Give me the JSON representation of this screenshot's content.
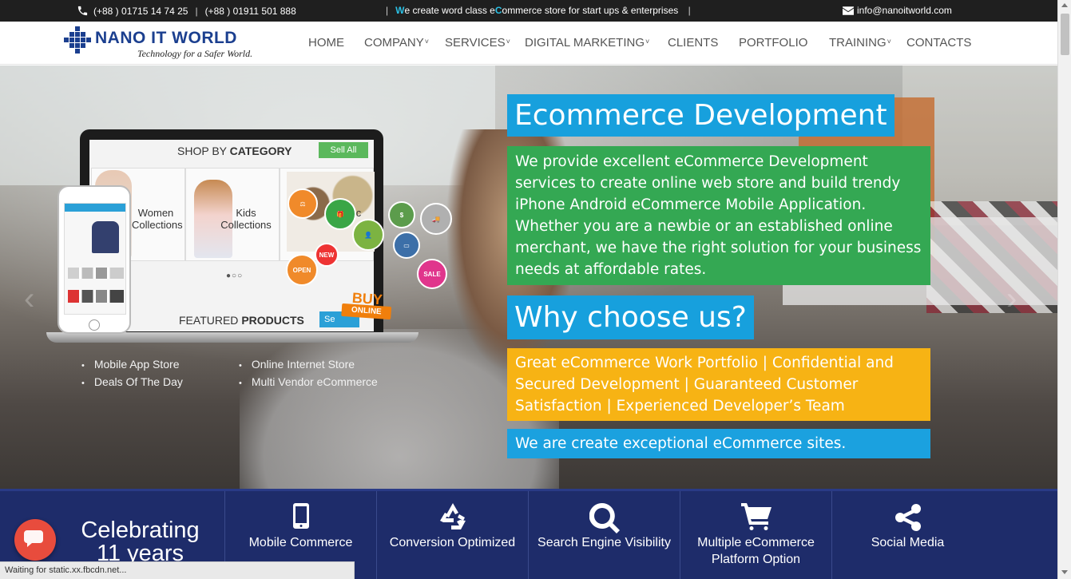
{
  "topbar": {
    "phone1": "(+88 ) 01715 14 74 25",
    "separator": "|",
    "phone2": "(+88 ) 01911 501 888",
    "tagline_prefix": "W",
    "tagline_mid1": "e create word class e",
    "tagline_hl2": "C",
    "tagline_rest": "ommerce store for start ups & enterprises",
    "tagline_bar": "|",
    "email": "info@nanoitworld.com"
  },
  "logo": {
    "name": "NANO IT WORLD",
    "slogan": "Technology for a Safer World."
  },
  "nav": {
    "items": [
      {
        "label": "HOME",
        "has_caret": false
      },
      {
        "label": "COMPANY",
        "has_caret": true
      },
      {
        "label": "SERVICES",
        "has_caret": true
      },
      {
        "label": "DIGITAL MARKETING",
        "has_caret": true
      },
      {
        "label": "CLIENTS",
        "has_caret": false
      },
      {
        "label": "PORTFOLIO",
        "has_caret": false
      },
      {
        "label": "TRAINING",
        "has_caret": true
      },
      {
        "label": "CONTACTS",
        "has_caret": false
      }
    ],
    "caret": "˅"
  },
  "hero_image": {
    "shop_title_a": "SHOP BY ",
    "shop_title_b": "CATEGORY",
    "sell_all": "Sell All",
    "cat_women": "Women Collections",
    "cat_kids": "Kids Collections",
    "cat_acc": "on Ac",
    "dots": "●○○",
    "featured_a": "FEATURED ",
    "featured_b": "PRODUCTS",
    "sell_btn2": "Se",
    "buy": "BUY",
    "online": "ONLINE",
    "badge_open": "OPEN",
    "badge_new": "NEW",
    "badge_sale": "SALE",
    "features": [
      "Mobile App Store",
      "Online Internet Store",
      "Deals Of The Day",
      "Multi Vendor eCommerce"
    ]
  },
  "panels": {
    "title1": "Ecommerce Development",
    "green_text": "We provide excellent eCommerce Development services to create online web store and build trendy iPhone Android eCommerce Mobile Application. Whether you are a newbie or an established online merchant, we have the right solution for your business needs at affordable rates.",
    "title2": "Why choose us?",
    "yellow_text": "Great eCommerce Work Portfolio | Confidential and Secured Development | Guaranteed Customer Satisfaction | Experienced Developer’s Team",
    "blue_text": "We are create exceptional eCommerce sites."
  },
  "strip": {
    "celebrate_line1": "Celebrating",
    "celebrate_line2": "11 years",
    "cells": [
      {
        "label": "Mobile Commerce",
        "icon": "mobile-icon"
      },
      {
        "label": "Conversion Optimized",
        "icon": "recycle-icon"
      },
      {
        "label": "Search Engine Visibility",
        "icon": "search-icon"
      },
      {
        "label": "Multiple eCommerce Platform Option",
        "icon": "cart-icon"
      },
      {
        "label": "Social Media",
        "icon": "share-icon"
      }
    ]
  },
  "status": {
    "text": "Waiting for static.xx.fbcdn.net..."
  },
  "colors": {
    "topbar_bg": "#1f1f1f",
    "accent_blue": "#17a0dd",
    "accent_green": "#34a853",
    "accent_yellow": "#f7b314",
    "strip_bg": "#1e2c6a",
    "chat_red": "#e84c3d"
  }
}
